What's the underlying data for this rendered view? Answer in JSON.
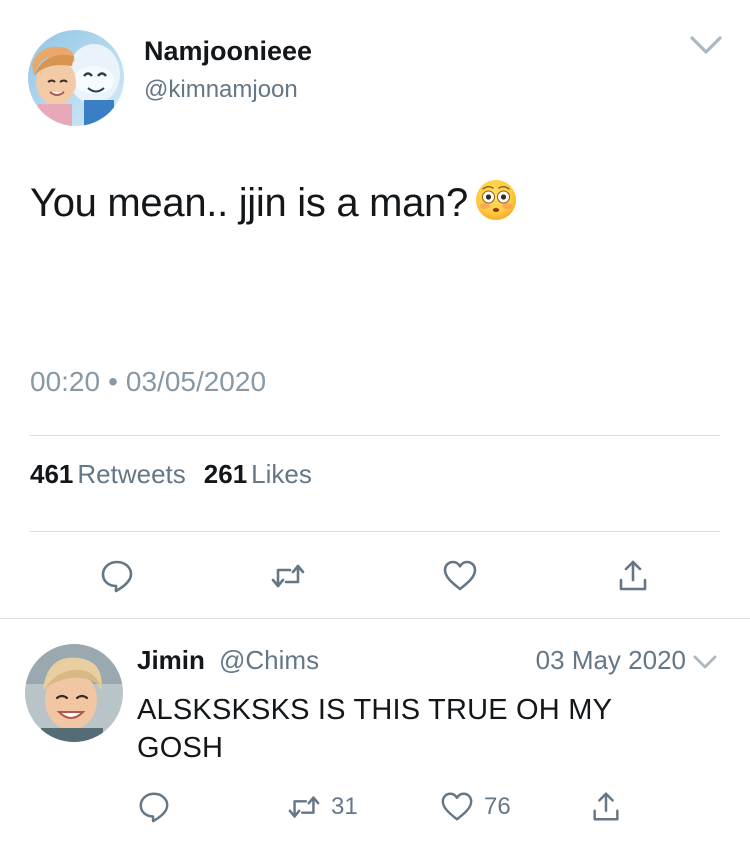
{
  "main_tweet": {
    "display_name": "Namjoonieee",
    "handle": "@kimnamjoon",
    "text": "You mean.. jjin is a man?",
    "emoji": "flushed-face",
    "time": "00:20",
    "date": "03/05/2020",
    "retweet_count": "461",
    "retweet_label": "Retweets",
    "like_count": "261",
    "like_label": "Likes"
  },
  "reply": {
    "display_name": "Jimin",
    "handle": "@Chims",
    "date": "03 May 2020",
    "text": "ALSKSKSKS IS THIS TRUE OH MY GOSH",
    "retweet_count": "31",
    "like_count": "76"
  },
  "colors": {
    "text": "#14171a",
    "secondary": "#657786",
    "timestamp": "#8899a6",
    "icon": "#657786",
    "divider": "#d8dde1"
  },
  "icons": [
    "chevron-down-icon",
    "reply-icon",
    "retweet-icon",
    "heart-icon",
    "share-icon"
  ]
}
